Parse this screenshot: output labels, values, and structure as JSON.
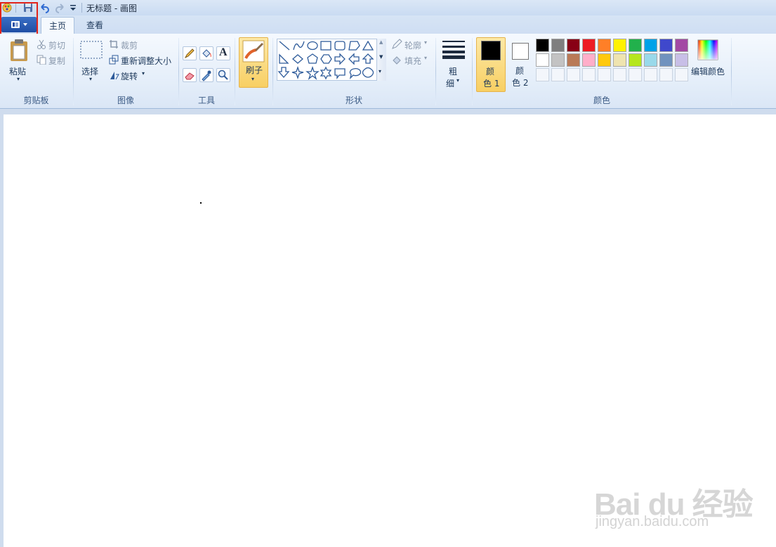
{
  "window": {
    "title": "无标题 - 画图"
  },
  "tabs": [
    {
      "label": "主页",
      "active": true
    },
    {
      "label": "查看",
      "active": false
    }
  ],
  "clipboard": {
    "paste": "粘贴",
    "cut": "剪切",
    "copy": "复制",
    "label": "剪贴板"
  },
  "image": {
    "select": "选择",
    "crop": "裁剪",
    "resize": "重新调整大小",
    "rotate": "旋转",
    "label": "图像"
  },
  "tools": {
    "label": "工具",
    "text_glyph": "A"
  },
  "brushes": {
    "label": "刷子"
  },
  "shapes": {
    "outline": "轮廓",
    "fill": "填充",
    "label": "形状"
  },
  "size": {
    "line1": "粗",
    "line2": "细"
  },
  "colors": {
    "color1_line1": "颜",
    "color1_line2": "色 1",
    "color2_line1": "颜",
    "color2_line2": "色 2",
    "edit": "编辑颜色",
    "label": "颜色",
    "color1_value": "#000000",
    "color2_value": "#ffffff",
    "palette_row1": [
      "#000000",
      "#7f7f7f",
      "#880015",
      "#ed1c24",
      "#ff7f27",
      "#fff200",
      "#22b14c",
      "#00a2e8",
      "#3f48cc",
      "#a349a4"
    ],
    "palette_row2": [
      "#ffffff",
      "#c3c3c3",
      "#b97a57",
      "#ffaec9",
      "#ffc90e",
      "#efe4b0",
      "#b5e61d",
      "#99d9ea",
      "#7092be",
      "#c8bfe7"
    ]
  },
  "watermark": {
    "logo": "Bai du 经验",
    "url": "jingyan.baidu.com"
  }
}
